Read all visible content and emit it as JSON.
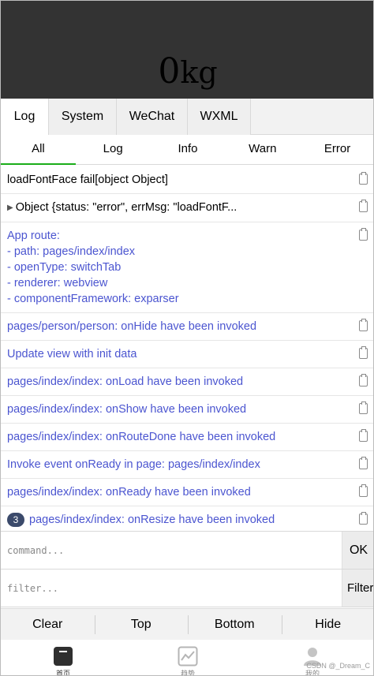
{
  "header": {
    "weight_value": "0",
    "weight_unit": "kg"
  },
  "console": {
    "main_tabs": [
      {
        "label": "Log",
        "active": true
      },
      {
        "label": "System",
        "active": false
      },
      {
        "label": "WeChat",
        "active": false
      },
      {
        "label": "WXML",
        "active": false
      }
    ],
    "sub_tabs": [
      {
        "label": "All",
        "active": true
      },
      {
        "label": "Log",
        "active": false
      },
      {
        "label": "Info",
        "active": false
      },
      {
        "label": "Warn",
        "active": false
      },
      {
        "label": "Error",
        "active": false
      }
    ],
    "logs": [
      {
        "color": "black",
        "lines": [
          "loadFontFace fail[object Object]"
        ]
      },
      {
        "color": "black",
        "expandable": true,
        "lines": [
          "Object {status: \"error\", errMsg: \"loadFontF..."
        ]
      },
      {
        "color": "blue",
        "lines": [
          "App route:",
          "- path: pages/index/index",
          "- openType: switchTab",
          "- renderer: webview",
          "- componentFramework: exparser"
        ]
      },
      {
        "color": "blue",
        "lines": [
          "pages/person/person: onHide have been invoked"
        ]
      },
      {
        "color": "blue",
        "lines": [
          "Update view with init data"
        ]
      },
      {
        "color": "blue",
        "lines": [
          "pages/index/index: onLoad have been invoked"
        ]
      },
      {
        "color": "blue",
        "lines": [
          "pages/index/index: onShow have been invoked"
        ]
      },
      {
        "color": "blue",
        "lines": [
          "pages/index/index: onRouteDone have been invoked"
        ]
      },
      {
        "color": "blue",
        "lines": [
          "Invoke event onReady in page: pages/index/index"
        ]
      },
      {
        "color": "blue",
        "lines": [
          "pages/index/index: onReady have been invoked"
        ]
      },
      {
        "color": "blue",
        "badge": "3",
        "lines": [
          "pages/index/index: onResize have been invoked"
        ]
      }
    ],
    "command_placeholder": "command...",
    "ok_label": "OK",
    "filter_placeholder": "filter...",
    "filter_label": "Filter",
    "actions": [
      "Clear",
      "Top",
      "Bottom",
      "Hide"
    ]
  },
  "tabbar": {
    "items": [
      {
        "label": "首页",
        "icon": "home-icon",
        "active": true
      },
      {
        "label": "趋势",
        "icon": "trend-chart-icon",
        "active": false
      },
      {
        "label": "我的",
        "icon": "person-icon",
        "active": false
      }
    ]
  },
  "watermark": "CSDN @_Dream_C",
  "colors": {
    "header_bg": "#333333",
    "log_blue": "#4b55d0",
    "active_underline": "#1aad19",
    "badge_bg": "#3b4a6b"
  }
}
